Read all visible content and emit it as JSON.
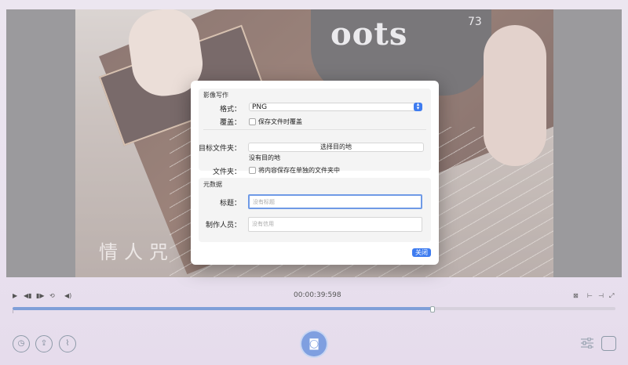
{
  "dialog": {
    "group1": {
      "title": "影像写作",
      "format_label": "格式：",
      "format_value": "PNG",
      "overwrite_label": "覆盖：",
      "overwrite_checkbox": "保存文件时覆盖",
      "dest_label": "目标文件夹：",
      "choose_button": "选择目的地",
      "no_destination": "没有目的地",
      "folder_label": "文件夹：",
      "folder_checkbox": "将内容保存在单独的文件夹中"
    },
    "group2": {
      "title": "元数据",
      "title_label": "标题：",
      "title_placeholder": "没有标题",
      "creator_label": "制作人员：",
      "creator_placeholder": "没有信用"
    },
    "close_button": "关闭"
  },
  "player": {
    "timecode": "00:00:39:598",
    "progress": 0.695
  },
  "video": {
    "shirt_text": "oots",
    "shirt_number": "73",
    "caption": "情人咒"
  },
  "colors": {
    "accent": "#3e7cf0",
    "capture": "#7f9fe0"
  }
}
